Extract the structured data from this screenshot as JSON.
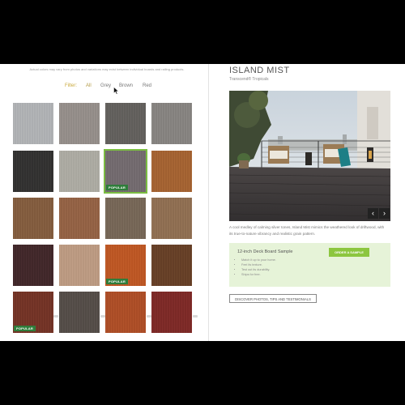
{
  "notice": "Actual colors may vary from photos and variations may exist between individual boards and railing products.",
  "filters": {
    "label": "Filter:",
    "options": [
      "All",
      "Grey",
      "Brown",
      "Red"
    ],
    "selected": "Grey"
  },
  "swatches": [
    {
      "name": "swatch-1",
      "colors": [
        "#a7a9ac",
        "#b6b8ba"
      ],
      "badge": ""
    },
    {
      "name": "swatch-2",
      "colors": [
        "#8b8581",
        "#9d9692"
      ],
      "badge": ""
    },
    {
      "name": "swatch-3",
      "colors": [
        "#5b5956",
        "#6a6764"
      ],
      "badge": ""
    },
    {
      "name": "swatch-4",
      "colors": [
        "#7d7a77",
        "#8f8c89"
      ],
      "badge": ""
    },
    {
      "name": "swatch-5",
      "colors": [
        "#2c2c2b",
        "#3a3938"
      ],
      "badge": ""
    },
    {
      "name": "swatch-6",
      "colors": [
        "#a4a39b",
        "#b2b0a8"
      ],
      "badge": ""
    },
    {
      "name": "swatch-7",
      "colors": [
        "#6a6266",
        "#7b7377"
      ],
      "badge": "POPULAR",
      "selected": true
    },
    {
      "name": "swatch-8",
      "colors": [
        "#9a5b2d",
        "#ad6a38"
      ],
      "badge": ""
    },
    {
      "name": "swatch-9",
      "colors": [
        "#7a5538",
        "#8b6446"
      ],
      "badge": ""
    },
    {
      "name": "swatch-10",
      "colors": [
        "#8a5a3e",
        "#9c6a4c"
      ],
      "badge": ""
    },
    {
      "name": "swatch-11",
      "colors": [
        "#6e5f50",
        "#7e6e5e"
      ],
      "badge": ""
    },
    {
      "name": "swatch-12",
      "colors": [
        "#86674b",
        "#987659"
      ],
      "badge": ""
    },
    {
      "name": "swatch-13",
      "colors": [
        "#3a2325",
        "#4a2e31"
      ],
      "badge": ""
    },
    {
      "name": "swatch-14",
      "colors": [
        "#b3927a",
        "#c2a189"
      ],
      "badge": ""
    },
    {
      "name": "swatch-15",
      "colors": [
        "#b4501f",
        "#c45e2b"
      ],
      "badge": "POPULAR"
    },
    {
      "name": "swatch-16",
      "colors": [
        "#5e3a22",
        "#6f472d"
      ],
      "badge": ""
    },
    {
      "name": "swatch-17",
      "colors": [
        "#6a2e22",
        "#7c3a2c"
      ],
      "badge": "POPULAR"
    },
    {
      "name": "swatch-18",
      "colors": [
        "#4d4641",
        "#5c5550"
      ],
      "badge": ""
    },
    {
      "name": "swatch-19",
      "colors": [
        "#a34722",
        "#b5552d"
      ],
      "badge": ""
    },
    {
      "name": "swatch-20",
      "colors": [
        "#742523",
        "#86302d"
      ],
      "badge": ""
    }
  ],
  "product": {
    "title": "ISLAND MIST",
    "subtitle": "Transcend® Tropicals",
    "description": "A cool medley of calming silver tones, Island Mist mimics the weathered look of driftwood, with its true-to-nature vibrancy and realistic grain pattern.",
    "gallery_prev": "‹",
    "gallery_next": "›"
  },
  "sample": {
    "title": "12-inch Deck Board Sample",
    "bullets": [
      "Match it up to your home.",
      "Feel its texture.",
      "Test out its durability.",
      "Ships for free."
    ],
    "order_label": "ORDER A SAMPLE"
  },
  "discover_label": "DISCOVER PHOTOS, TIPS AND TESTIMONIALS",
  "colors": {
    "accent_green": "#8cc63f",
    "popular_badge": "#2f7d3b",
    "filter_gold": "#c9a83b"
  }
}
